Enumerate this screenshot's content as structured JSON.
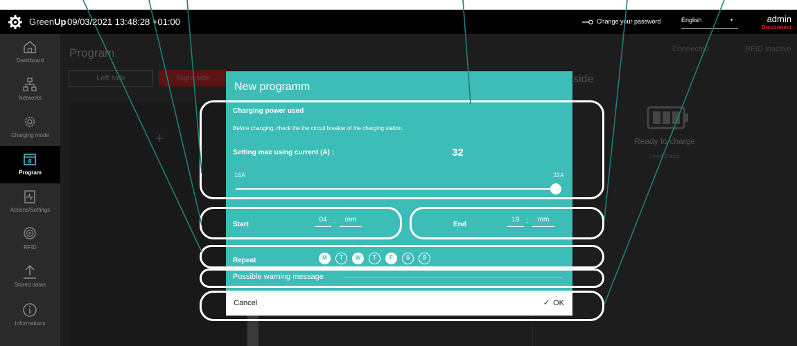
{
  "topbar": {
    "brand_light": "Green",
    "brand_bold": "Up",
    "datetime": "09/03/2021 13:48:28 +01:00",
    "change_password": "Change your password",
    "language": "English",
    "user": "admin",
    "disconnect": "Disconnect"
  },
  "sidebar": {
    "items": [
      {
        "label": "Dashboard",
        "icon": "home-icon"
      },
      {
        "label": "Networks",
        "icon": "network-icon"
      },
      {
        "label": "Charging mode",
        "icon": "gear-icon"
      },
      {
        "label": "Program",
        "icon": "calendar-icon",
        "active": true
      },
      {
        "label": "Actions/Settings",
        "icon": "clipboard-icon"
      },
      {
        "label": "RFID",
        "icon": "rfid-icon"
      },
      {
        "label": "Stored datas",
        "icon": "upload-icon"
      },
      {
        "label": "Informations",
        "icon": "info-icon"
      }
    ]
  },
  "main": {
    "title": "Program",
    "tab_left": "Left side",
    "tab_right": "Right side",
    "side_right": "side",
    "status_connected": "Connected",
    "status_rfid": "RFID Inactive",
    "ready": "Ready to charge",
    "ready_sub": "Smart Charge"
  },
  "modal": {
    "title": "New programm",
    "charging_title": "Charging power used",
    "charging_warning": "Before changing, check the the circuit breaker of the charging station.",
    "max_label": "Setting max using current (A) :",
    "max_value": "32",
    "min_amp": "16A",
    "max_amp": "32A",
    "slider_fraction": 1.0,
    "start_label": "Start",
    "start_hh": "04",
    "start_mm": "mm",
    "end_label": "End",
    "end_hh": "19",
    "end_mm": "mm",
    "repeat_label": "Repeat",
    "days": [
      {
        "letter": "M",
        "on": true
      },
      {
        "letter": "T",
        "on": false
      },
      {
        "letter": "W",
        "on": true
      },
      {
        "letter": "T",
        "on": false
      },
      {
        "letter": "F",
        "on": true
      },
      {
        "letter": "S",
        "on": false
      },
      {
        "letter": "S",
        "on": false
      }
    ],
    "warning_message": "Possible warning message",
    "cancel": "Cancel",
    "ok": "OK"
  },
  "colors": {
    "teal": "#3dbdb7",
    "topbar": "#000000",
    "sidebar": "#2a2a2a",
    "disconnect": "#e0242f",
    "annotation": "#ffffff"
  }
}
